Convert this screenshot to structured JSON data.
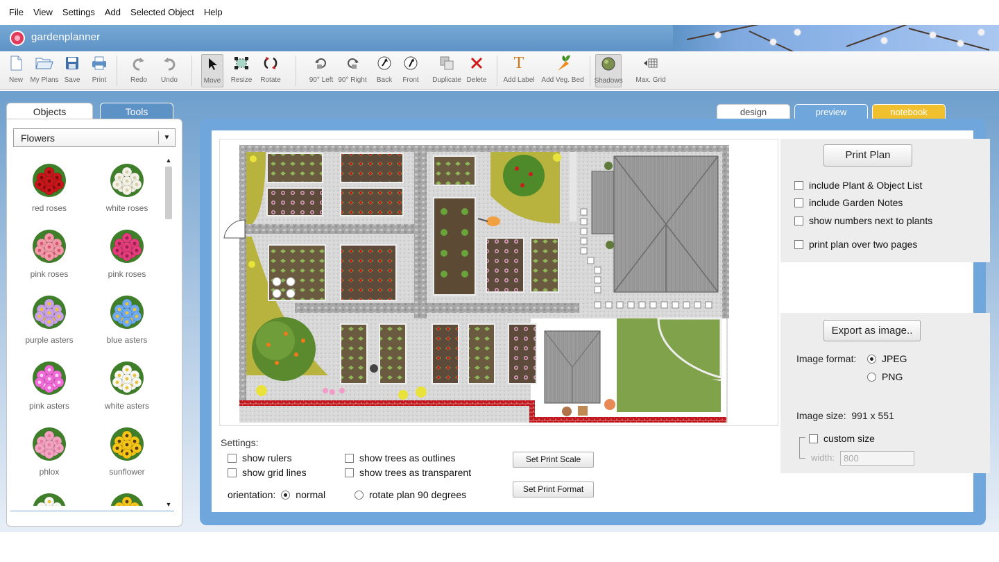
{
  "menu": [
    "File",
    "View",
    "Settings",
    "Add",
    "Selected Object",
    "Help"
  ],
  "brand": {
    "name": "gardenplanner"
  },
  "toolbar": {
    "new": "New",
    "my_plans": "My Plans",
    "save": "Save",
    "print": "Print",
    "redo": "Redo",
    "undo": "Undo",
    "move": "Move",
    "resize": "Resize",
    "rotate": "Rotate",
    "rot_left": "90° Left",
    "rot_right": "90° Right",
    "back": "Back",
    "front": "Front",
    "duplicate": "Duplicate",
    "delete": "Delete",
    "add_label": "Add Label",
    "add_veg_bed": "Add Veg. Bed",
    "shadows": "Shadows",
    "max_grid": "Max. Grid"
  },
  "left_panel": {
    "tabs": {
      "objects": "Objects",
      "tools": "Tools"
    },
    "category": "Flowers",
    "plants": [
      {
        "label": "red roses",
        "icon": "red-roses-icon",
        "color": "#c8161b",
        "center": "#7a0a0c"
      },
      {
        "label": "white roses",
        "icon": "white-roses-icon",
        "color": "#f4f1e6",
        "center": "#d6cfae"
      },
      {
        "label": "pink roses",
        "icon": "pink-roses-icon",
        "color": "#f29aa8",
        "center": "#d4566f"
      },
      {
        "label": "pink roses",
        "icon": "pink-roses-icon",
        "color": "#e33d7c",
        "center": "#9e1e4e"
      },
      {
        "label": "purple asters",
        "icon": "purple-asters-icon",
        "color": "#c9a2e6",
        "center": "#e8c23b"
      },
      {
        "label": "blue asters",
        "icon": "blue-asters-icon",
        "color": "#6eaaf0",
        "center": "#e8c23b"
      },
      {
        "label": "pink asters",
        "icon": "pink-asters-icon",
        "color": "#f06ad8",
        "center": "#ffd6f4"
      },
      {
        "label": "white asters",
        "icon": "white-asters-icon",
        "color": "#f8f8f2",
        "center": "#e8c23b"
      },
      {
        "label": "phlox",
        "icon": "phlox-icon",
        "color": "#f3a3c0",
        "center": "#e37fa6"
      },
      {
        "label": "sunflower",
        "icon": "sunflower-icon",
        "color": "#f5c518",
        "center": "#5a3a12"
      }
    ]
  },
  "view_tabs": {
    "design": "design",
    "preview": "preview",
    "notebook": "notebook"
  },
  "settings": {
    "label": "Settings:",
    "show_rulers": "show rulers",
    "show_grid_lines": "show grid lines",
    "show_trees_outlines": "show trees as outlines",
    "show_trees_transparent": "show trees as transparent",
    "orientation_label": "orientation:",
    "orientation_normal": "normal",
    "orientation_rotate": "rotate plan 90 degrees",
    "set_print_scale": "Set Print Scale",
    "set_print_format": "Set Print Format"
  },
  "print_panel": {
    "print_plan": "Print Plan",
    "include_list": "include Plant & Object List",
    "include_notes": "include Garden Notes",
    "show_numbers": "show numbers next to plants",
    "two_pages": "print plan over two pages"
  },
  "export_panel": {
    "export_button": "Export as image..",
    "format_label": "Image format:",
    "jpeg": "JPEG",
    "png": "PNG",
    "size_label": "Image size:",
    "size_value": "991 x 551",
    "custom_size": "custom size",
    "width_label": "width:",
    "width_value": "800"
  },
  "colors": {
    "accent_blue": "#6fa7dc",
    "notebook_tab": "#f0c02e",
    "grass": "#7fa24a",
    "path_gray": "#d9d9d9",
    "brick": "#c0141a"
  }
}
